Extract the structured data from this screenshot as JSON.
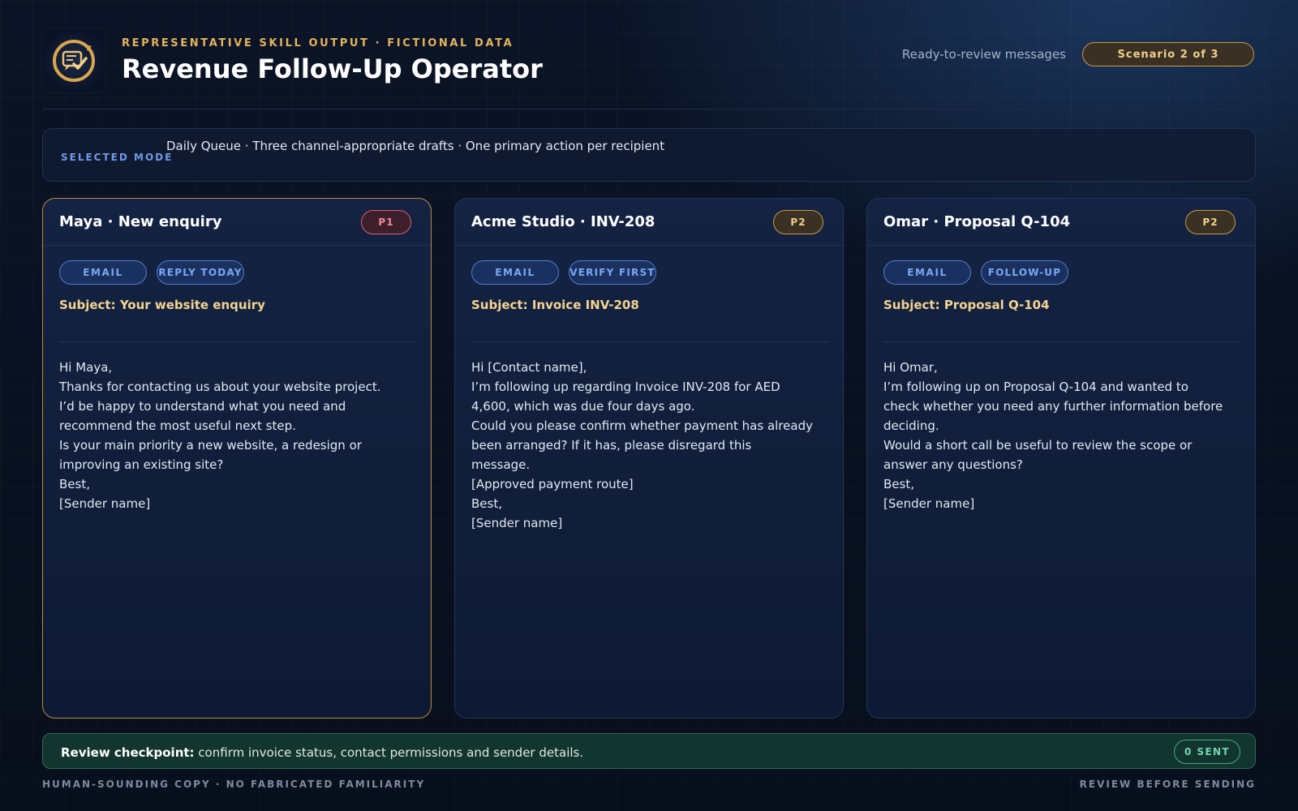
{
  "header": {
    "logo_icon": "chat-check-icon",
    "eyebrow": "REPRESENTATIVE SKILL OUTPUT · FICTIONAL DATA",
    "title": "Revenue Follow-Up Operator",
    "ready_label": "Ready-to-review messages",
    "scenario_badge": "Scenario 2 of 3"
  },
  "mode": {
    "label": "SELECTED MODE",
    "text": "Daily Queue · Three channel-appropriate drafts · One primary action per recipient"
  },
  "cards": [
    {
      "title": "Maya · New enquiry",
      "priority": "P1",
      "chips": [
        "EMAIL",
        "REPLY TODAY"
      ],
      "subject": "Subject: Your website enquiry",
      "body": [
        "Hi Maya,",
        "Thanks for contacting us about your website project.",
        "I’d be happy to understand what you need and",
        "recommend the most useful next step.",
        "Is your main priority a new website, a redesign or",
        "improving an existing site?",
        "Best,",
        "[Sender name]"
      ]
    },
    {
      "title": "Acme Studio · INV-208",
      "priority": "P2",
      "chips": [
        "EMAIL",
        "VERIFY FIRST"
      ],
      "subject": "Subject: Invoice INV-208",
      "body": [
        "Hi [Contact name],",
        "I’m following up regarding Invoice INV-208 for AED",
        "4,600, which was due four days ago.",
        "Could you please confirm whether payment has already",
        "been arranged? If it has, please disregard this",
        "message.",
        "[Approved payment route]",
        "Best,",
        "[Sender name]"
      ]
    },
    {
      "title": "Omar · Proposal Q-104",
      "priority": "P2",
      "chips": [
        "EMAIL",
        "FOLLOW-UP"
      ],
      "subject": "Subject: Proposal Q-104",
      "body": [
        "Hi Omar,",
        "I’m following up on Proposal Q-104 and wanted to",
        "check whether you need any further information before",
        "deciding.",
        "Would a short call be useful to review the scope or",
        "answer any questions?",
        "Best,",
        "[Sender name]"
      ]
    }
  ],
  "checkpoint": {
    "label": "Review checkpoint:",
    "text": " confirm invoice status, contact permissions and sender details.",
    "sent_badge": "0 SENT"
  },
  "footer": {
    "left": "HUMAN-SOUNDING COPY · NO FABRICATED FAMILIARITY",
    "right": "REVIEW BEFORE SENDING"
  },
  "colors": {
    "accent_gold": "#e5b35a",
    "accent_blue": "#79a7f3",
    "priority_high": "#f08a93",
    "success_green": "#6fd8ad"
  }
}
